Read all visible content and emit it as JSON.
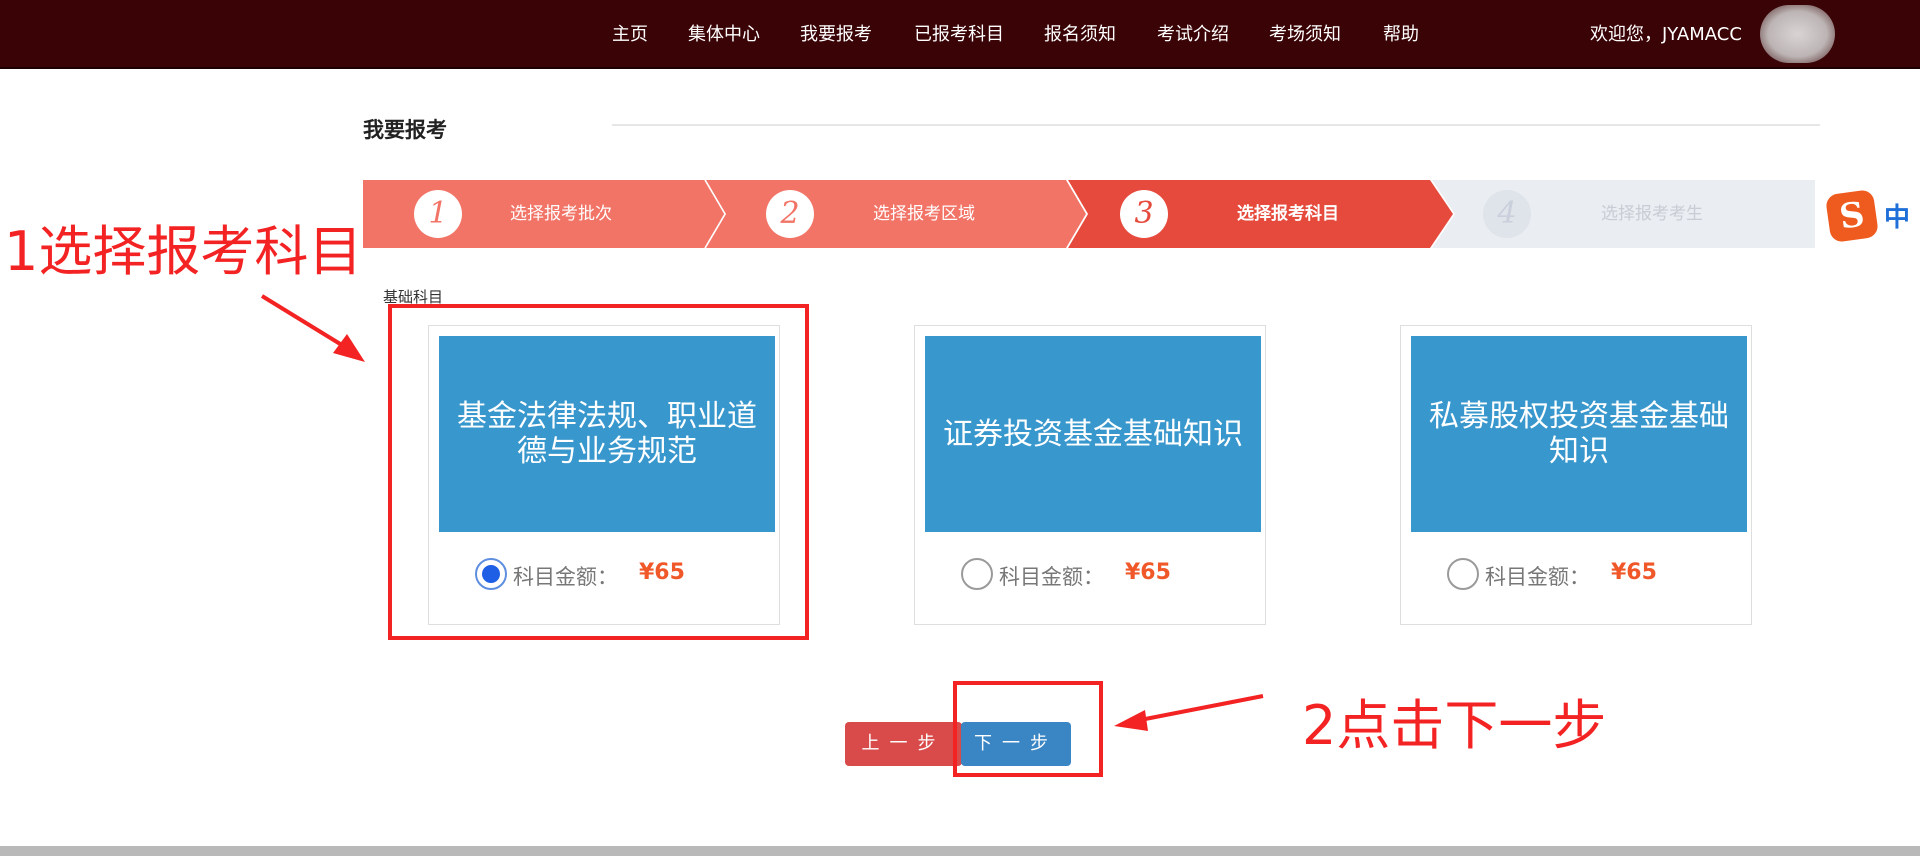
{
  "nav": {
    "items": [
      "主页",
      "集体中心",
      "我要报考",
      "已报考科目",
      "报名须知",
      "考试介绍",
      "考场须知",
      "帮助"
    ],
    "welcome": "欢迎您，JYAMACC"
  },
  "page": {
    "title": "我要报考"
  },
  "stepper": {
    "steps": [
      {
        "number": "1",
        "label": "选择报考批次",
        "state": "done"
      },
      {
        "number": "2",
        "label": "选择报考区域",
        "state": "done"
      },
      {
        "number": "3",
        "label": "选择报考科目",
        "state": "active"
      },
      {
        "number": "4",
        "label": "选择报考考生",
        "state": "pending"
      }
    ]
  },
  "ime": {
    "badge": "S",
    "mode": "中"
  },
  "category": "基础科目",
  "subjects": [
    {
      "name": "基金法律法规、职业道德与业务规范",
      "price_label": "科目金额：",
      "price": "¥65",
      "selected": true
    },
    {
      "name": "证券投资基金基础知识",
      "price_label": "科目金额：",
      "price": "¥65",
      "selected": false
    },
    {
      "name": "私募股权投资基金基础知识",
      "price_label": "科目金额：",
      "price": "¥65",
      "selected": false
    }
  ],
  "buttons": {
    "prev": "上一步",
    "next": "下一步"
  },
  "annotations": {
    "step1": "1选择报考科目",
    "step2": "2点击下一步"
  },
  "colors": {
    "nav_bg": "#3a0306",
    "step_done": "#f27467",
    "step_active": "#e64a3c",
    "step_pending": "#eaedf2",
    "card_banner": "#3897cd",
    "price": "#f0582a",
    "annotation": "#f42323",
    "prev_button": "#d94b4b",
    "next_button": "#3a86c5"
  }
}
